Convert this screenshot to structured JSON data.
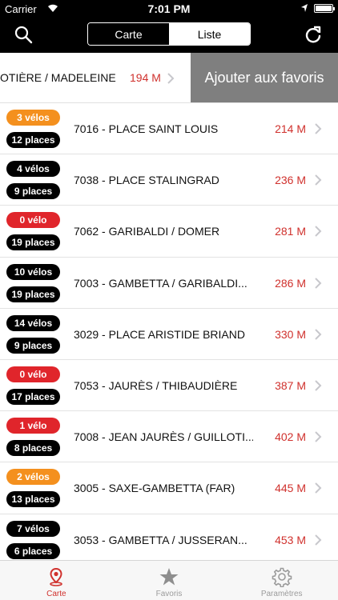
{
  "status_bar": {
    "carrier": "Carrier",
    "time": "7:01 PM"
  },
  "nav": {
    "segments": [
      {
        "label": "Carte",
        "selected": false
      },
      {
        "label": "Liste",
        "selected": true
      }
    ]
  },
  "swiped_row": {
    "name": "OTIÈRE / MADELEINE",
    "distance": "194 M",
    "action_label": "Ajouter aux favoris"
  },
  "stations": [
    {
      "bikes": "3 vélos",
      "bikes_color": "#f4901e",
      "places": "12 places",
      "name": "7016 - PLACE SAINT LOUIS",
      "distance": "214 M"
    },
    {
      "bikes": "4 vélos",
      "bikes_color": "#000000",
      "places": "9 places",
      "name": "7038 - PLACE STALINGRAD",
      "distance": "236 M"
    },
    {
      "bikes": "0 vélo",
      "bikes_color": "#e0252b",
      "places": "19 places",
      "name": "7062 - GARIBALDI / DOMER",
      "distance": "281 M"
    },
    {
      "bikes": "10 vélos",
      "bikes_color": "#000000",
      "places": "19 places",
      "name": "7003 - GAMBETTA / GARIBALDI...",
      "distance": "286 M"
    },
    {
      "bikes": "14 vélos",
      "bikes_color": "#000000",
      "places": "9 places",
      "name": "3029 - PLACE ARISTIDE BRIAND",
      "distance": "330 M"
    },
    {
      "bikes": "0 vélo",
      "bikes_color": "#e0252b",
      "places": "17 places",
      "name": "7053 - JAURÈS / THIBAUDIÈRE",
      "distance": "387 M"
    },
    {
      "bikes": "1 vélo",
      "bikes_color": "#e0252b",
      "places": "8 places",
      "name": "7008 - JEAN JAURÈS / GUILLOTI...",
      "distance": "402 M"
    },
    {
      "bikes": "2 vélos",
      "bikes_color": "#f4901e",
      "places": "13 places",
      "name": "3005 - SAXE-GAMBETTA (FAR)",
      "distance": "445 M"
    },
    {
      "bikes": "7 vélos",
      "bikes_color": "#000000",
      "places": "6 places",
      "name": "3053 - GAMBETTA / JUSSERAN...",
      "distance": "453 M"
    }
  ],
  "tabs": [
    {
      "label": "Carte",
      "icon": "map-pin-icon",
      "active": true
    },
    {
      "label": "Favoris",
      "icon": "star-icon",
      "active": false
    },
    {
      "label": "Paramètres",
      "icon": "gear-icon",
      "active": false
    }
  ],
  "colors": {
    "accent": "#d0312d",
    "tab_inactive": "#9b9b9b",
    "swipe_action_bg": "#7f7f7f"
  }
}
